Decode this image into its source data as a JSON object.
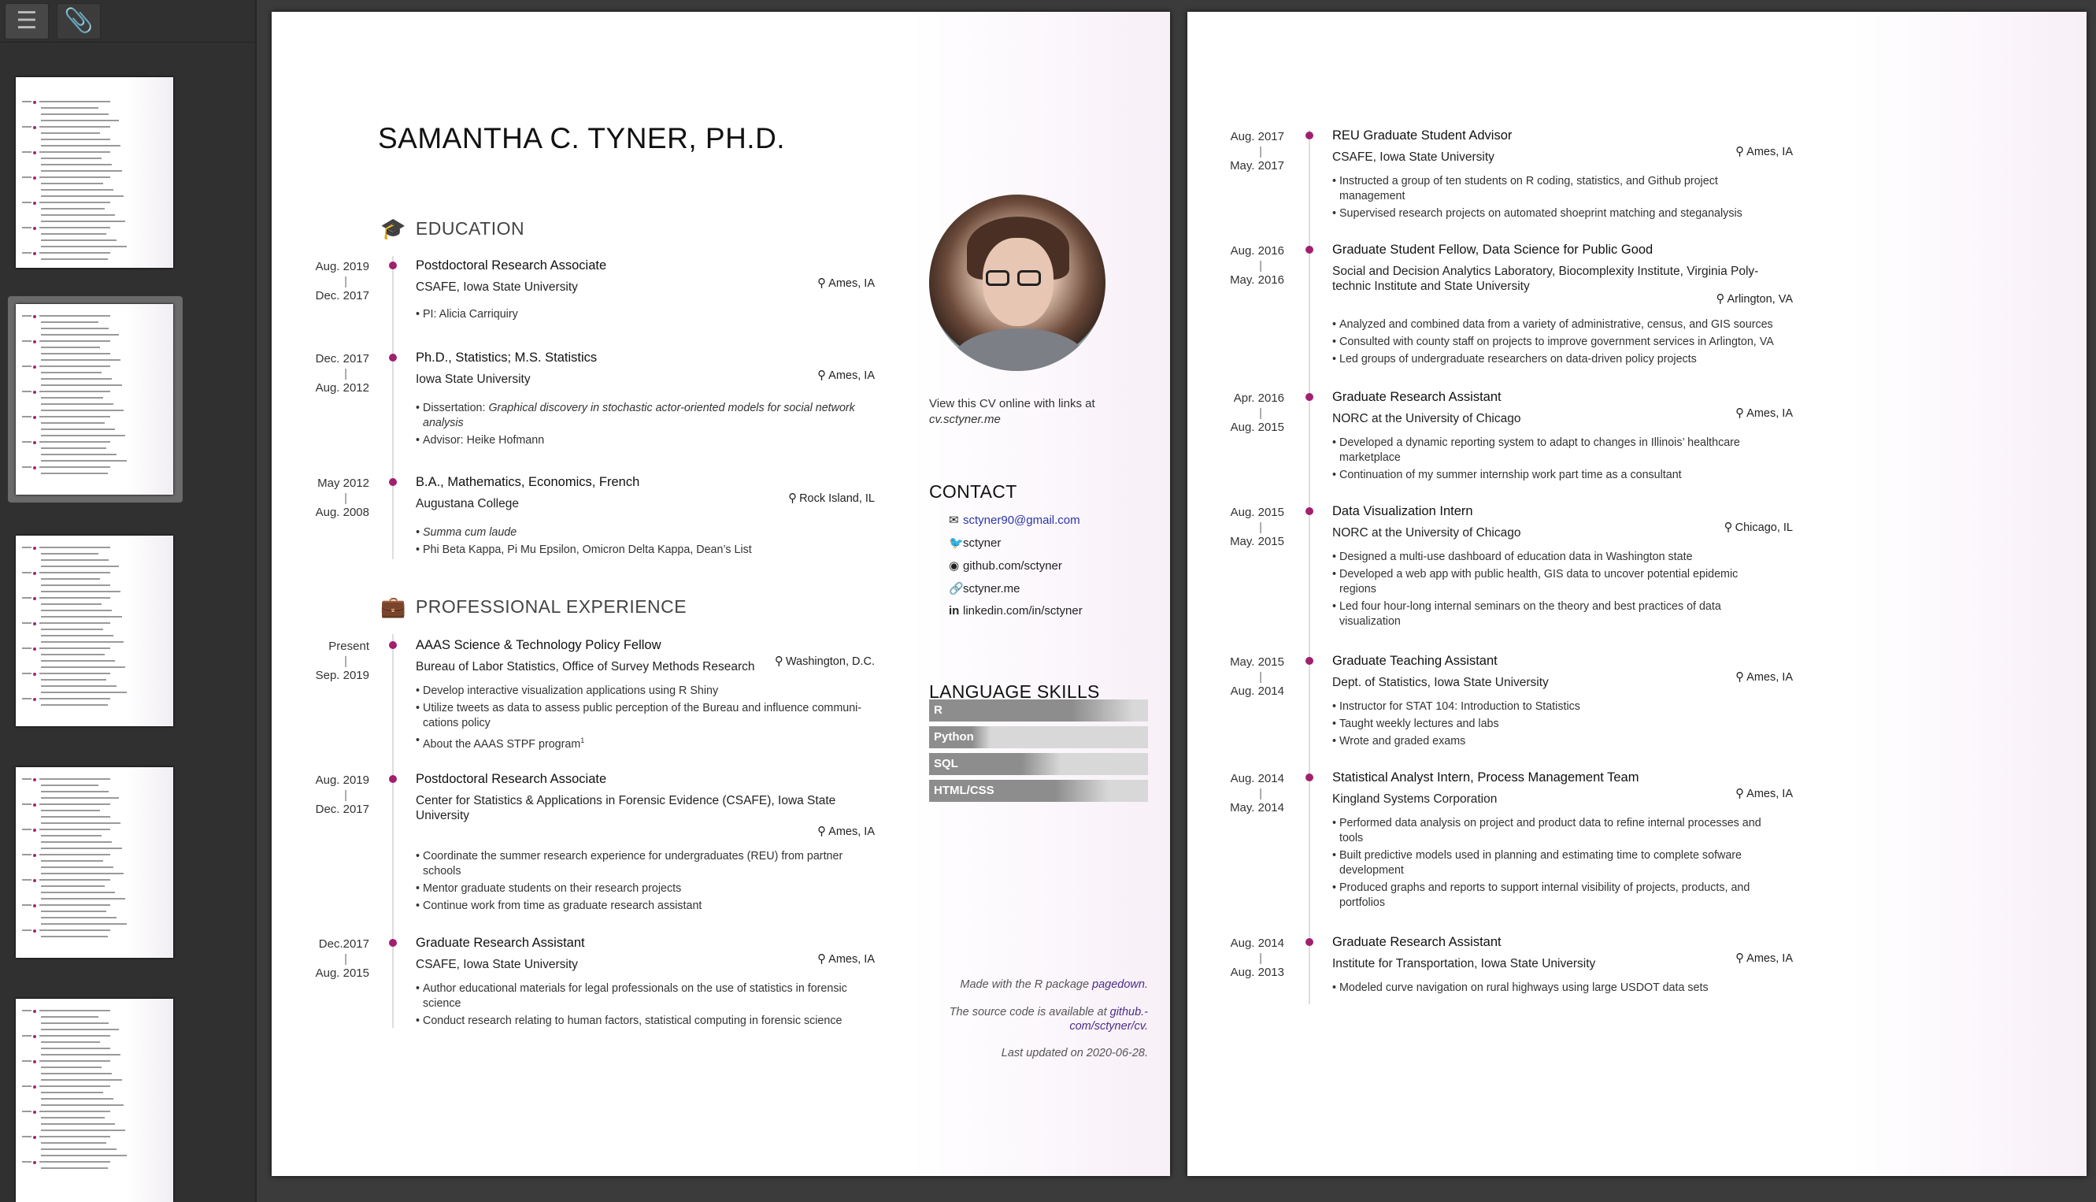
{
  "toolbar": {
    "outline_icon": "list-icon",
    "attach_icon": "paperclip-icon"
  },
  "thumbnails": [
    {
      "page": 1
    },
    {
      "page": 2,
      "active": true
    },
    {
      "page": 3
    },
    {
      "page": 4
    },
    {
      "page": 5
    }
  ],
  "page1": {
    "name": "SAMANTHA C. TYNER, PH.D.",
    "education_title": "EDUCATION",
    "experience_title": "PROFESSIONAL EXPERIENCE",
    "education": [
      {
        "start": "Aug. 2019",
        "end": "Dec. 2017",
        "title": "Postdoctoral Research Associate",
        "org": "CSAFE, Iowa State University",
        "loc": "Ames, IA",
        "bullets": [
          "PI: Alicia Carriquiry"
        ]
      },
      {
        "start": "Dec. 2017",
        "end": "Aug. 2012",
        "title": "Ph.D., Statistics; M.S. Statistics",
        "org": "Iowa State University",
        "loc": "Ames, IA",
        "bullet1_pre": "Dissertation: ",
        "bullet1_it": "Graphical discovery in stochastic actor-oriented models for social network",
        "bullet1_it2": "analysis",
        "bullet2": "Advisor: Heike Hofmann"
      },
      {
        "start": "May 2012",
        "end": "Aug. 2008",
        "title": "B.A., Mathematics, Economics, French",
        "org": "Augustana College",
        "loc": "Rock Island, IL",
        "bullets": [
          "Summa cum laude",
          "Phi Beta Kappa, Pi Mu Epsilon, Omicron Delta Kappa, Dean’s List"
        ]
      }
    ],
    "experience": [
      {
        "start": "Present",
        "end": "Sep. 2019",
        "title": "AAAS Science & Technology Policy Fellow",
        "org": "Bureau of Labor Statistics, Office of Survey Methods Research",
        "loc": "Washington, D.C.",
        "bullets": [
          "Develop interactive visualization applications using R Shiny",
          "Utilize tweets as data to assess public perception of the Bureau and influence communi-",
          "cations policy",
          "About the AAAS STPF program"
        ],
        "sup": "1"
      },
      {
        "start": "Aug. 2019",
        "end": "Dec. 2017",
        "title": "Postdoctoral Research Associate",
        "org": "Center for Statistics & Applications in Forensic Evidence (CSAFE), Iowa State",
        "org2": "University",
        "loc": "Ames, IA",
        "bullets": [
          "Coordinate the summer research experience for undergraduates (REU) from partner",
          "schools",
          "Mentor graduate students on their research projects",
          "Continue work from time as graduate research assistant"
        ]
      },
      {
        "start": "Dec.2017",
        "end": "Aug. 2015",
        "title": "Graduate Research Assistant",
        "org": "CSAFE, Iowa State University",
        "loc": "Ames, IA",
        "bullets": [
          "Author educational materials for legal professionals on the use of statistics in forensic",
          "science",
          "Conduct research relating to human factors, statistical computing in forensic science"
        ]
      }
    ],
    "view_note": "View this CV online with links at",
    "view_url": "cv.sctyner.me",
    "contact_title": "CONTACT",
    "contact": [
      {
        "icon": "envelope-icon",
        "text": "sctyner90@gmail.com"
      },
      {
        "icon": "twitter-icon",
        "text": "sctyner"
      },
      {
        "icon": "github-icon",
        "text": "github.com/sctyner"
      },
      {
        "icon": "link-icon",
        "text": "sctyner.me"
      },
      {
        "icon": "linkedin-icon",
        "text": "linkedin.com/in/sctyner"
      }
    ],
    "skills_title": "LANGUAGE SKILLS",
    "skills": [
      {
        "name": "R",
        "level": 0.93
      },
      {
        "name": "Python",
        "level": 0.28
      },
      {
        "name": "SQL",
        "level": 0.6
      },
      {
        "name": "HTML/CSS",
        "level": 0.82
      }
    ],
    "footer1_pre": "Made with the R package ",
    "footer1_link": "pagedown",
    "footer1_post": ".",
    "footer2_pre": "The source code is available at ",
    "footer2_link": "github.-",
    "footer2_link2": "com/sctyner/cv.",
    "footer3": "Last updated on 2020-06-28."
  },
  "page2": {
    "entries": [
      {
        "start": "Aug. 2017",
        "end": "May. 2017",
        "title": "REU Graduate Student Advisor",
        "org": "CSAFE, Iowa State University",
        "loc": "Ames, IA",
        "bullets": [
          "Instructed a group of ten students on R coding, statistics, and Github project",
          "management",
          "Supervised research projects on automated shoeprint matching and steganalysis"
        ]
      },
      {
        "start": "Aug. 2016",
        "end": "May. 2016",
        "title": "Graduate Student Fellow, Data Science for Public Good",
        "org": "Social and Decision Analytics Laboratory, Biocomplexity Institute, Virginia Poly-",
        "org2": "technic Institute and State University",
        "loc": "Arlington, VA",
        "bullets": [
          "Analyzed and combined data from a variety of administrative, census, and GIS sources",
          "Consulted with county staff on projects to improve government services in Arlington, VA",
          "Led groups of undergraduate researchers on data-driven policy projects"
        ]
      },
      {
        "start": "Apr. 2016",
        "end": "Aug. 2015",
        "title": "Graduate Research Assistant",
        "org": "NORC at the University of Chicago",
        "loc": "Ames, IA",
        "bullets": [
          "Developed a dynamic reporting system to adapt to changes in Illinois’ healthcare",
          "marketplace",
          "Continuation of my summer internship work part time as a consultant"
        ]
      },
      {
        "start": "Aug. 2015",
        "end": "May. 2015",
        "title": "Data Visualization Intern",
        "org": "NORC at the University of Chicago",
        "loc": "Chicago, IL",
        "bullets": [
          "Designed a multi-use dashboard of education data in Washington state",
          "Developed a web app with public health, GIS data to uncover potential epidemic",
          "regions",
          "Led four hour-long internal seminars on the theory and best practices of data",
          "visualization"
        ]
      },
      {
        "start": "May. 2015",
        "end": "Aug. 2014",
        "title": "Graduate Teaching Assistant",
        "org": "Dept. of Statistics, Iowa State University",
        "loc": "Ames, IA",
        "bullets": [
          "Instructor for STAT 104: Introduction to Statistics",
          "Taught weekly lectures and labs",
          "Wrote and graded exams"
        ]
      },
      {
        "start": "Aug. 2014",
        "end": "May. 2014",
        "title": "Statistical Analyst Intern, Process Management Team",
        "org": "Kingland Systems Corporation",
        "loc": "Ames, IA",
        "bullets": [
          "Performed data analysis on project and product data to refine internal processes and",
          "tools",
          "Built predictive models used in planning and estimating time to complete sofware",
          "development",
          "Produced graphs and reports to support internal visibility of projects, products, and",
          "portfolios"
        ]
      },
      {
        "start": "Aug. 2014",
        "end": "Aug. 2013",
        "title": "Graduate Research Assistant",
        "org": "Institute for Transportation, Iowa State University",
        "loc": "Ames, IA",
        "bullets": [
          "Modeled curve navigation on rural highways using large USDOT data sets"
        ]
      }
    ]
  },
  "colors": {
    "accent": "#a0206e",
    "skill_fill": "#8d8d8d",
    "background": "#3b3b3b"
  }
}
